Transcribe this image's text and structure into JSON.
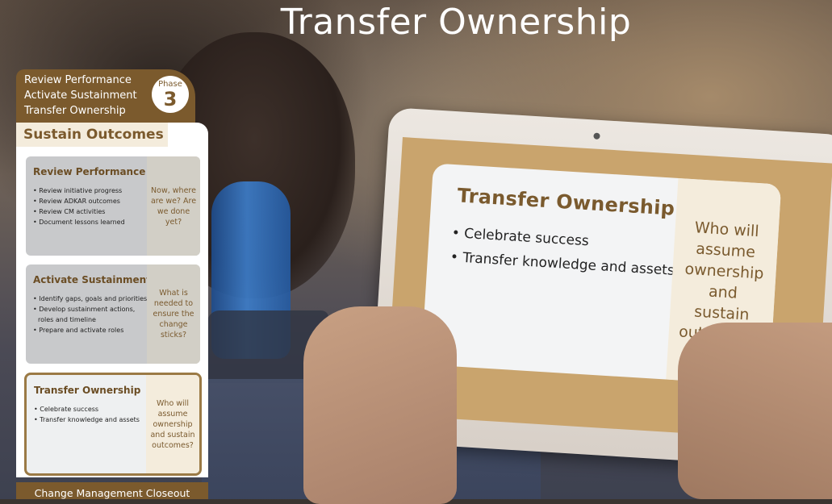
{
  "page": {
    "title": "Transfer Ownership"
  },
  "phase_header": {
    "items": [
      "Review Performance",
      "Activate Sustainment",
      "Transfer Ownership"
    ],
    "badge_label": "Phase",
    "badge_number": "3"
  },
  "panel": {
    "title": "Sustain Outcomes",
    "cards": [
      {
        "title": "Review Performance",
        "bullets": [
          "Review initiative progress",
          "Review ADKAR outcomes",
          "Review CM activities",
          "Document lessons learned"
        ],
        "question": "Now, where are we? Are we done yet?"
      },
      {
        "title": "Activate Sustainment",
        "bullets": [
          "Identify gaps, goals and priorities",
          "Develop sustainment actions, roles and timeline",
          "Prepare and activate roles"
        ],
        "question": "What is needed to ensure the change sticks?"
      },
      {
        "title": "Transfer Ownership",
        "bullets": [
          "Celebrate success",
          "Transfer knowledge and assets"
        ],
        "question": "Who will assume ownership and sustain outcomes?"
      }
    ],
    "footer": "Change Management Closeout"
  },
  "tablet_slide": {
    "title": "Transfer Ownership",
    "bullets": [
      "Celebrate success",
      "Transfer knowledge and assets"
    ],
    "question": "Who will assume ownership and sustain outcomes?"
  },
  "colors": {
    "brand_brown": "#7b5a2d",
    "accent_tan": "#c9a46d",
    "cream": "#f4ecdc"
  }
}
